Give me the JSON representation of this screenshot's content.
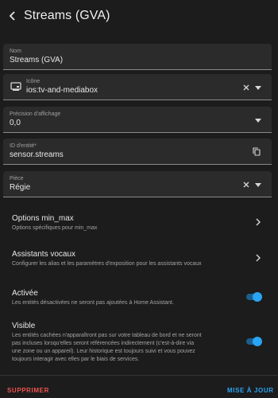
{
  "header": {
    "title": "Streams (GVA)",
    "back_icon": "back-arrow-icon"
  },
  "fields": {
    "name": {
      "label": "Nom",
      "value": "Streams (GVA)"
    },
    "icon": {
      "label": "Icône",
      "value": "ios:tv-and-mediabox",
      "icon_name": "tv-monitor-icon"
    },
    "precision": {
      "label": "Précision d'affichage",
      "value": "0,0"
    },
    "entity_id": {
      "label": "ID d'entité*",
      "value": "sensor.streams"
    },
    "area": {
      "label": "Pièce",
      "value": "Régie"
    }
  },
  "rows": {
    "min_max": {
      "title": "Options min_max",
      "subtitle": "Options spécifiques pour min_max"
    },
    "voice": {
      "title": "Assistants vocaux",
      "subtitle": "Configurer les alias et les paramètres d'exposition pour les assistants vocaux"
    }
  },
  "toggles": {
    "enabled": {
      "title": "Activée",
      "subtitle": "Les entités désactivées ne seront pas ajoutées à Home Assistant.",
      "on": true
    },
    "visible": {
      "title": "Visible",
      "subtitle_lines": [
        "Les entités cachées n'apparaîtront pas sur votre tableau de bord et ne seront",
        "pas incluses lorsqu'elles seront référencées indirectement (c'est-à-dire via",
        "une zone ou un appareil). Leur historique est toujours suivi et vous pouvez",
        "toujours interagir avec elles par le biais de services."
      ],
      "on": true
    }
  },
  "footer": {
    "delete_label": "SUPPRIMER",
    "update_label": "MISE À JOUR"
  },
  "colors": {
    "accent": "#2aa4f4",
    "danger": "#ef5350",
    "background": "#1c1c1c",
    "field_bg": "#2b2b2b"
  }
}
